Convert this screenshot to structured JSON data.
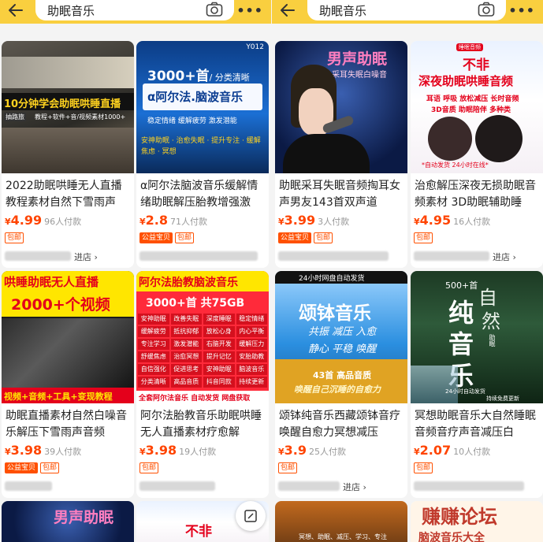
{
  "search": {
    "query": "助眠音乐"
  },
  "icons": {
    "back": "back-arrow-icon",
    "camera": "camera-icon",
    "more": "more-icon",
    "edit": "edit-icon"
  },
  "colors": {
    "topbar": "#f9cf3f",
    "price": "#ff4400",
    "tag": "#ff5000"
  },
  "left": {
    "cards": [
      {
        "thumb_text": [
          "10分钟学会助眠哄睡直播",
          "抽路旅",
          "教程+软件+音/视频素材1000+"
        ],
        "title": "2022助眠哄睡无人直播教程素材自然下雪雨声",
        "price": "4.99",
        "sold": "96人付款",
        "tags": [
          "包邮"
        ],
        "store": "进店"
      },
      {
        "thumb_text": [
          "Y012",
          "3000+首",
          "/ 分类清晰",
          "α阿尔法.脑波音乐",
          "稳定情绪  缓解疲劳  激发潜能",
          "安神助眠 · 治愈失眠 · 提升专注 · 缓解焦虑 · 冥想"
        ],
        "title": "α阿尔法脑波音乐缓解情绪助眠解压胎教增强激",
        "price": "2.8",
        "sold": "71人付款",
        "tags": [
          "公益宝贝",
          "包邮"
        ],
        "store": ""
      },
      {
        "thumb_text": [
          "哄睡助眠无人直播",
          "2000+个视频",
          "视频+音频+工具+变现教程"
        ],
        "title": "助眠直播素材自然白噪音乐解压下雪雨声音频",
        "price": "3.98",
        "sold": "39人付款",
        "tags": [
          "公益宝贝",
          "包邮"
        ],
        "store": ""
      },
      {
        "thumb_text": [
          "阿尔法胎教脑波音乐",
          "3000+首  共75GB",
          "安神助眠",
          "改善失眠",
          "深度睡眠",
          "稳定情绪",
          "缓解疲劳",
          "抵抗抑郁",
          "放松心身",
          "内心平衡",
          "专注学习",
          "激发潜能",
          "右脑开发",
          "缓解压力",
          "舒缓焦虑",
          "治愈冥想",
          "提升记忆",
          "安胎助教",
          "自信强化",
          "促进思考",
          "安神助眠",
          "脑波音乐",
          "分类清晰",
          "高品音质",
          "抖音同款",
          "持续更新",
          "全套阿尔法音乐  自动发货  网盘获取"
        ],
        "title": "阿尔法胎教音乐助眠哄睡无人直播素材疗愈解",
        "price": "3.98",
        "sold": "19人付款",
        "tags": [
          "包邮"
        ],
        "store": ""
      }
    ],
    "partial": [
      {
        "thumb_text": [
          "男声助眠"
        ]
      },
      {
        "thumb_text": [
          "不非"
        ]
      }
    ]
  },
  "right": {
    "cards": [
      {
        "thumb_text": [
          "男声助眠",
          "采耳失眠白噪音"
        ],
        "title": "助眠采耳失眠音频掏耳女声男友143首双声道",
        "price": "3.99",
        "sold": "3人付款",
        "tags": [
          "公益宝贝",
          "包邮"
        ],
        "store": ""
      },
      {
        "thumb_text": [
          "睡眠音频",
          "不非",
          "深夜助眠哄睡音频",
          "耳语 呼吸 放松减压 长时音频",
          "3D音质 助眠陪伴 多种类",
          "*自动发货  24小时在线*"
        ],
        "title": "治愈解压深夜无损助眠音频素材 3D助眠辅助睡",
        "price": "4.95",
        "sold": "16人付款",
        "tags": [
          "包邮"
        ],
        "store": "进店"
      },
      {
        "thumb_text": [
          "24小时网盘自动发货",
          "颂钵音乐",
          "共振 减压 入愈",
          "静心 平稳 唤醒",
          "43首 高品音质",
          "唤醒自己沉睡的自愈力"
        ],
        "title": "颂钵纯音乐西藏颂钵音疗唤醒自愈力冥想减压",
        "price": "3.9",
        "sold": "25人付款",
        "tags": [
          "包邮"
        ],
        "store": "进店"
      },
      {
        "thumb_text": [
          "500+首",
          "自",
          "然",
          "纯",
          "音",
          "乐",
          "助眠",
          "24小时自动发货",
          "持续免费更新"
        ],
        "title": "冥想助眠音乐大自然睡眠音频音疗声音减压白",
        "price": "2.07",
        "sold": "10人付款",
        "tags": [
          "包邮"
        ],
        "store": ""
      }
    ],
    "partial": [
      {
        "thumb_text": [
          "冥想、助眠、减压、学习、专注"
        ]
      },
      {
        "thumb_text": [
          "赚赚论坛",
          "脑波音乐大全"
        ]
      }
    ]
  }
}
